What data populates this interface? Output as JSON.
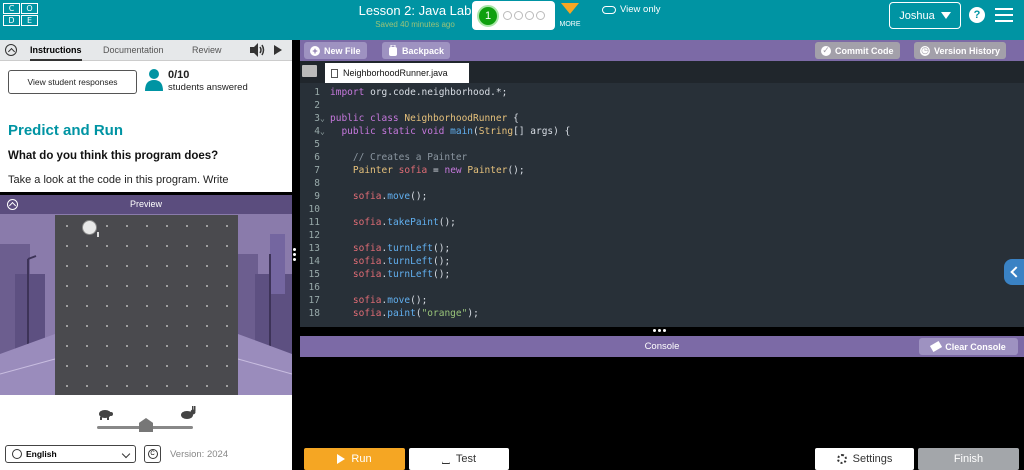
{
  "header": {
    "logo_letters": [
      "C",
      "O",
      "D",
      "E",
      "",
      ""
    ],
    "lesson_title": "Lesson 2: Java Lab",
    "saved_status": "Saved 40 minutes ago",
    "current_level": "1",
    "more_label": "MORE",
    "user_name": "Joshua",
    "help_label": "?"
  },
  "instructions": {
    "tabs": [
      "Instructions",
      "Documentation",
      "Review"
    ],
    "view_responses_button": "View student responses",
    "answered_count": "0/10",
    "answered_label": "students answered",
    "heading": "Predict and Run",
    "question": "What do you think this program does?",
    "body_text": "Take a look at the code in this program. Write"
  },
  "preview": {
    "title": "Preview"
  },
  "controls": {
    "language": "English",
    "version": "Version: 2024"
  },
  "editor": {
    "new_file_button": "New File",
    "backpack_button": "Backpack",
    "view_only_label": "View only",
    "commit_button": "Commit Code",
    "version_history_button": "Version History",
    "file_tab": "NeighborhoodRunner.java",
    "line_numbers": [
      "1",
      "2",
      "3",
      "4",
      "5",
      "6",
      "7",
      "8",
      "9",
      "10",
      "11",
      "12",
      "13",
      "14",
      "15",
      "16",
      "17",
      "18"
    ]
  },
  "console": {
    "title": "Console",
    "clear_button": "Clear Console"
  },
  "footer": {
    "run_button": "Run",
    "test_button": "Test",
    "settings_button": "Settings",
    "finish_button": "Finish"
  },
  "colors": {
    "header_teal": "#0094a3",
    "editor_purple": "#7c6aa6",
    "run_orange": "#f5a623",
    "code_bg": "#283038"
  }
}
